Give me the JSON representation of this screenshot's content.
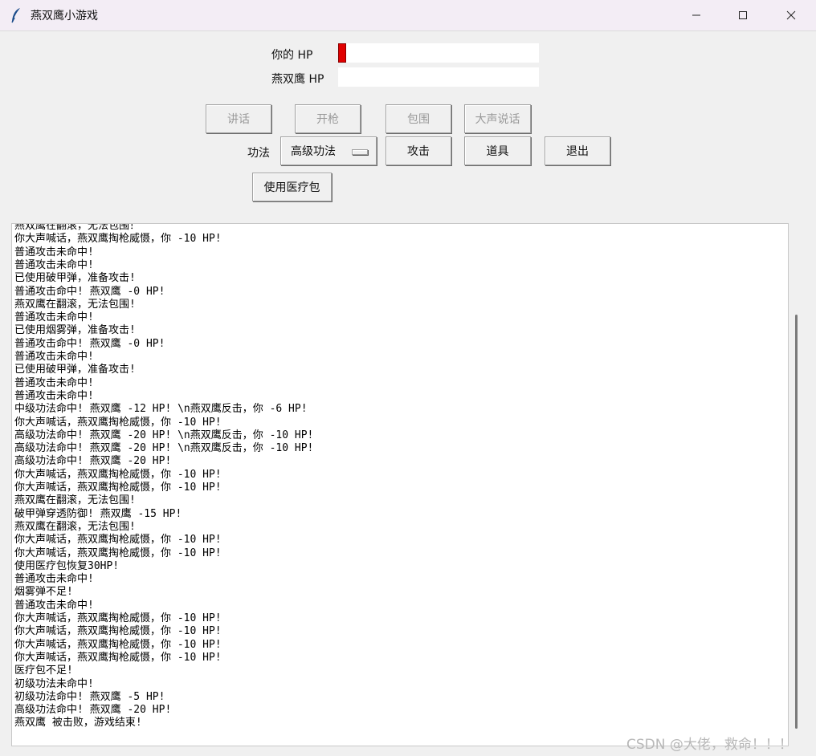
{
  "window": {
    "title": "燕双鹰小游戏",
    "controls": [
      "minimize",
      "maximize",
      "close"
    ]
  },
  "hp": {
    "player_label": "你的 HP",
    "player_fraction": 0.04,
    "enemy_label": "燕双鹰 HP",
    "enemy_fraction": 0.0,
    "player_color": "#e00000"
  },
  "buttons": {
    "talk": "讲话",
    "shoot": "开枪",
    "surround": "包围",
    "shout": "大声说话",
    "attack": "攻击",
    "items": "道具",
    "quit": "退出",
    "use_medkit": "使用医疗包"
  },
  "skill": {
    "label": "功法",
    "selected": "高级功法"
  },
  "log": {
    "lines": [
      "燕双鹰在翻滚，无法包围！",
      "你大声喊话，燕双鹰掏枪威慑，你 -10 HP!",
      "普通攻击未命中!",
      "普通攻击未命中!",
      "已使用破甲弹，准备攻击!",
      "普通攻击命中! 燕双鹰 -0 HP!",
      "燕双鹰在翻滚，无法包围!",
      "普通攻击未命中!",
      "已使用烟雾弹，准备攻击!",
      "普通攻击命中! 燕双鹰 -0 HP!",
      "普通攻击未命中!",
      "已使用破甲弹，准备攻击!",
      "普通攻击未命中!",
      "普通攻击未命中!",
      "中级功法命中! 燕双鹰 -12 HP! \\n燕双鹰反击，你 -6 HP!",
      "你大声喊话，燕双鹰掏枪威慑，你 -10 HP!",
      "高级功法命中! 燕双鹰 -20 HP! \\n燕双鹰反击，你 -10 HP!",
      "高级功法命中! 燕双鹰 -20 HP! \\n燕双鹰反击，你 -10 HP!",
      "高级功法命中! 燕双鹰 -20 HP!",
      "你大声喊话，燕双鹰掏枪威慑，你 -10 HP!",
      "你大声喊话，燕双鹰掏枪威慑，你 -10 HP!",
      "燕双鹰在翻滚，无法包围!",
      "破甲弹穿透防御! 燕双鹰 -15 HP!",
      "燕双鹰在翻滚，无法包围!",
      "你大声喊话，燕双鹰掏枪威慑，你 -10 HP!",
      "你大声喊话，燕双鹰掏枪威慑，你 -10 HP!",
      "使用医疗包恢复30HP!",
      "普通攻击未命中!",
      "烟雾弹不足!",
      "普通攻击未命中!",
      "你大声喊话，燕双鹰掏枪威慑，你 -10 HP!",
      "你大声喊话，燕双鹰掏枪威慑，你 -10 HP!",
      "你大声喊话，燕双鹰掏枪威慑，你 -10 HP!",
      "你大声喊话，燕双鹰掏枪威慑，你 -10 HP!",
      "医疗包不足!",
      "初级功法未命中!",
      "初级功法命中! 燕双鹰 -5 HP!",
      "高级功法命中! 燕双鹰 -20 HP!",
      "燕双鹰 被击败，游戏结束!"
    ]
  },
  "watermark": "CSDN @大佬，救命！！！"
}
